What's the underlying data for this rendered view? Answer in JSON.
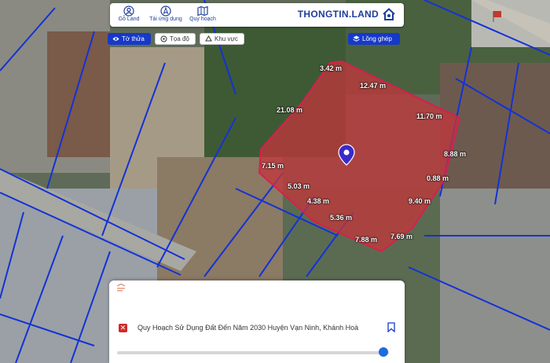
{
  "topbar": {
    "nav": [
      {
        "label": "Gỗ Land",
        "icon": "user-icon"
      },
      {
        "label": "Tải ứng dụng",
        "icon": "compass-icon"
      },
      {
        "label": "Quy hoạch",
        "icon": "map-icon"
      }
    ],
    "logo_text": "THONGTIN.LAND"
  },
  "controls": {
    "to_thua": "Tờ thửa",
    "toa_do": "Tọa độ",
    "khu_vuc": "Khu vực",
    "long_ghep": "Lồng ghép"
  },
  "measurements": [
    {
      "text": "3.42 m"
    },
    {
      "text": "12.47 m"
    },
    {
      "text": "21.08 m"
    },
    {
      "text": "11.70 m"
    },
    {
      "text": "8.88 m"
    },
    {
      "text": "0.88 m"
    },
    {
      "text": "7.15 m"
    },
    {
      "text": "5.03 m"
    },
    {
      "text": "4.38 m"
    },
    {
      "text": "9.40 m"
    },
    {
      "text": "5.36 m"
    },
    {
      "text": "7.69 m"
    },
    {
      "text": "7.88 m"
    }
  ],
  "panel": {
    "plan_title": "Quy Hoạch Sử Dụng Đất Đến Năm 2030 Huyện Vạn Ninh, Khánh Hoà",
    "close_label": "✕",
    "opacity_level": 0.98
  },
  "colors": {
    "brand": "#1f3e9a",
    "parcel_fill": "#c4353b",
    "parcel_outline": "#d81f4d",
    "boundary": "#1432d6"
  }
}
